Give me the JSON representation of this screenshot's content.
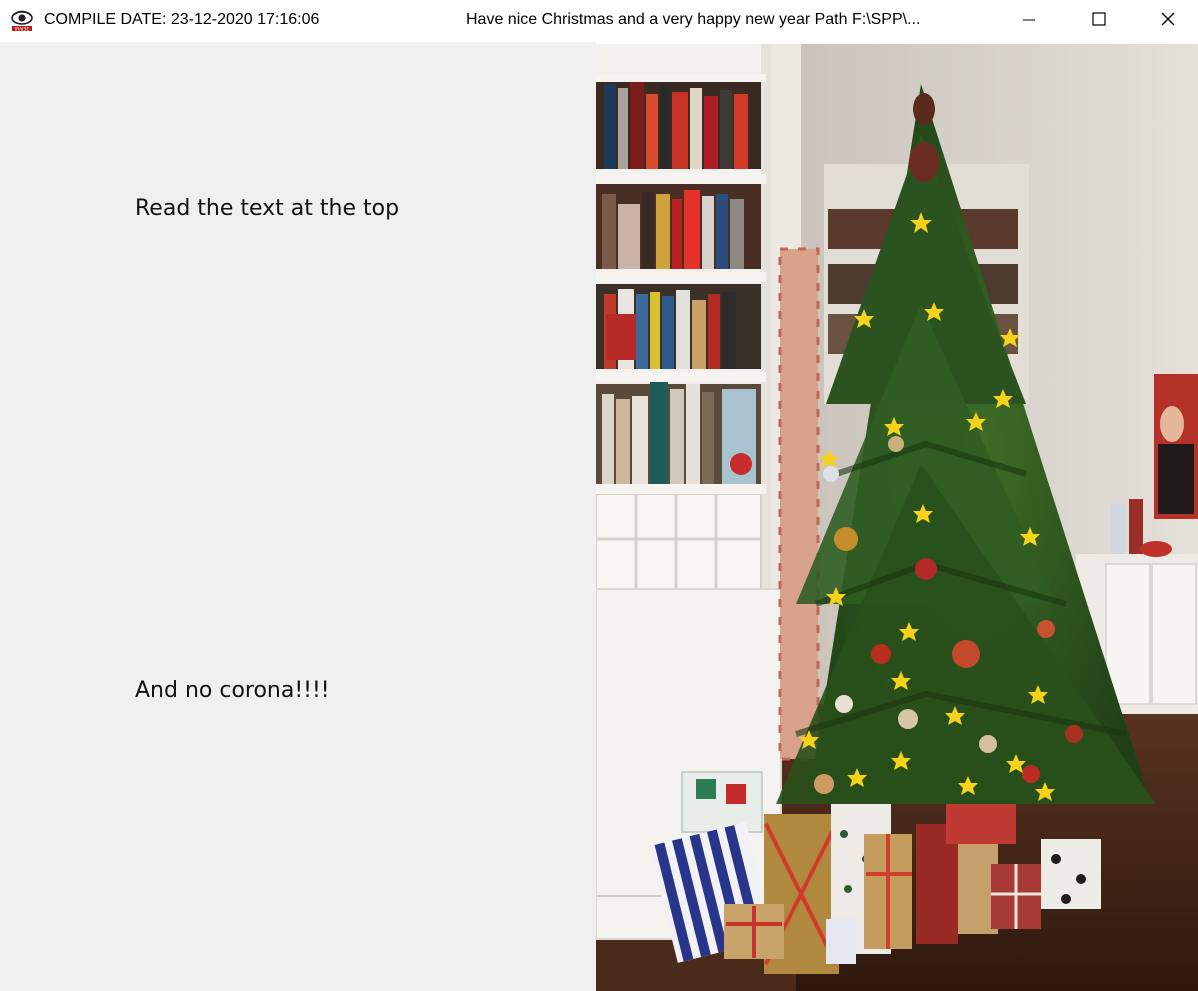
{
  "window": {
    "compile_date": "COMPILE DATE: 23-12-2020 17:16:06",
    "title": "Have nice Christmas and a very happy new year  Path F:\\SPP\\...",
    "app_icon": "eye-logo-icon",
    "controls": {
      "minimize_icon": "minimize-icon",
      "maximize_icon": "maximize-icon",
      "close_icon": "close-icon"
    }
  },
  "panel": {
    "line1": "Read the text at the top",
    "line2": "And no corona!!!!"
  },
  "photo": {
    "subject": "christmas-tree-photo",
    "colors": {
      "wall": "#d4cec6",
      "shelf": "#f2f0ec",
      "tree": "#2f5a1f",
      "floor": "#4a2a1a",
      "star": "#f6d21a"
    }
  }
}
